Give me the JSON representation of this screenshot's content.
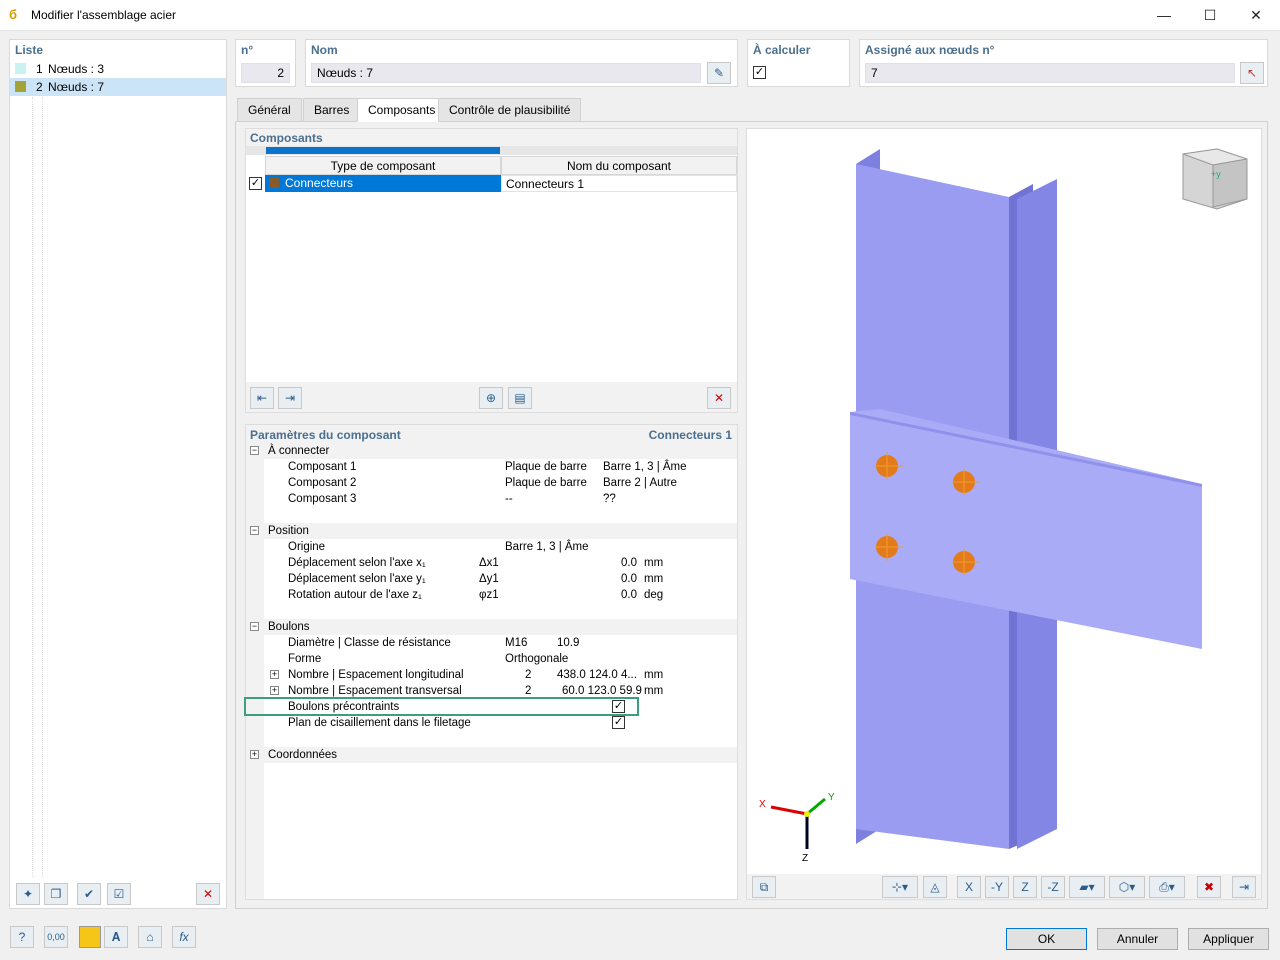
{
  "window": {
    "title": "Modifier l'assemblage acier",
    "minimize": "—",
    "maximize": "☐",
    "close": "✕"
  },
  "list": {
    "header": "Liste",
    "items": [
      {
        "num": "1",
        "label": "Nœuds : 3",
        "color": "#c9f3f3"
      },
      {
        "num": "2",
        "label": "Nœuds : 7",
        "color": "#a3a336"
      }
    ]
  },
  "top": {
    "no_label": "n°",
    "no_value": "2",
    "name_label": "Nom",
    "name_value": "Nœuds : 7",
    "calc_label": "À calculer",
    "calc_checked": "✓",
    "assigned_label": "Assigné aux nœuds n°",
    "assigned_value": "7"
  },
  "tabs": [
    "Général",
    "Barres",
    "Composants",
    "Contrôle de plausibilité"
  ],
  "components": {
    "header": "Composants",
    "col_type": "Type de composant",
    "col_name": "Nom du composant",
    "row": {
      "type": "Connecteurs",
      "name": "Connecteurs 1",
      "checked": "✓"
    }
  },
  "params": {
    "header": "Paramètres du composant",
    "header_right": "Connecteurs 1",
    "sections": {
      "connect": "À connecter",
      "position": "Position",
      "bolts": "Boulons",
      "coords": "Coordonnées"
    },
    "connect_rows": [
      {
        "label": "Composant 1",
        "v1": "Plaque de barre",
        "v2": "Barre 1, 3 | Âme"
      },
      {
        "label": "Composant 2",
        "v1": "Plaque de barre",
        "v2": "Barre 2 | Autre"
      },
      {
        "label": "Composant 3",
        "v1": "--",
        "v2": "??"
      }
    ],
    "position_rows": [
      {
        "label": "Origine",
        "sym": "",
        "value": "Barre 1, 3 | Âme",
        "unit": ""
      },
      {
        "label": "Déplacement selon l'axe x₁",
        "sym": "Δx1",
        "value": "0.0",
        "unit": "mm"
      },
      {
        "label": "Déplacement selon l'axe y₁",
        "sym": "Δy1",
        "value": "0.0",
        "unit": "mm"
      },
      {
        "label": "Rotation autour de l'axe z₁",
        "sym": "φz1",
        "value": "0.0",
        "unit": "deg"
      }
    ],
    "bolt_rows": [
      {
        "label": "Diamètre | Classe de résistance",
        "a": "M16",
        "b": "10.9",
        "unit": ""
      },
      {
        "label": "Forme",
        "a": "Orthogonale",
        "b": "",
        "unit": ""
      },
      {
        "label": "Nombre | Espacement longitudinal",
        "a": "2",
        "b": "438.0 124.0 4...",
        "unit": "mm"
      },
      {
        "label": "Nombre | Espacement transversal",
        "a": "2",
        "b": "60.0 123.0 59.9",
        "unit": "mm"
      },
      {
        "label": "Boulons précontraints",
        "a": "",
        "b": "",
        "unit": ""
      },
      {
        "label": "Plan de cisaillement dans le filetage",
        "a": "",
        "b": "",
        "unit": ""
      }
    ]
  },
  "viewer": {
    "axis_x": "X",
    "axis_y": "Y",
    "axis_z": "Z",
    "cube_label": "+y",
    "beam_color": "#9a9cf2",
    "bolt_color": "#e47a1a"
  },
  "footer": {
    "ok": "OK",
    "cancel": "Annuler",
    "apply": "Appliquer"
  }
}
